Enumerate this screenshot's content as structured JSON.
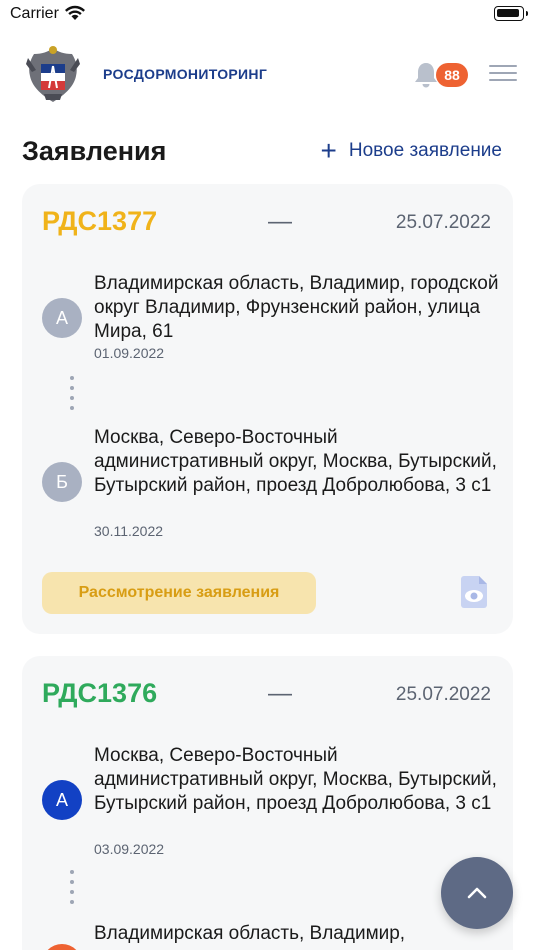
{
  "status_bar": {
    "carrier": "Carrier"
  },
  "header": {
    "brand": "РОСДОРМОНИТОРИНГ",
    "notifications_count": "88"
  },
  "page": {
    "title": "Заявления",
    "new_application_label": "Новое заявление"
  },
  "colors": {
    "brand": "#1c3d8b",
    "badge": "#ee6232",
    "id_pending": "#f0b31a",
    "id_done": "#2faa5c",
    "status_pending_bg": "#f7e4ae",
    "status_pending_text": "#d89d14"
  },
  "applications": [
    {
      "id": "РДС1377",
      "separator": "—",
      "date": "25.07.2022",
      "points": [
        {
          "letter": "А",
          "address": "Владимирская область, Владимир, городской округ Владимир, Фрунзенский район, улица Мира, 61",
          "date": "01.09.2022"
        },
        {
          "letter": "Б",
          "address": "Москва, Северо-Восточный административный округ, Москва, Бутырский, Бутырский район, проезд Добролюбова, 3 с1",
          "date": "30.11.2022"
        }
      ],
      "status": "Рассмотрение заявления",
      "doc_icon": "document-view-icon"
    },
    {
      "id": "РДС1376",
      "separator": "—",
      "date": "25.07.2022",
      "points": [
        {
          "letter": "А",
          "address": "Москва, Северо-Восточный административный округ, Москва, Бутырский, Бутырский район, проезд Добролюбова, 3 с1",
          "date": "03.09.2022"
        },
        {
          "letter": "",
          "address": "Владимирская область, Владимир,",
          "date": ""
        }
      ]
    }
  ]
}
